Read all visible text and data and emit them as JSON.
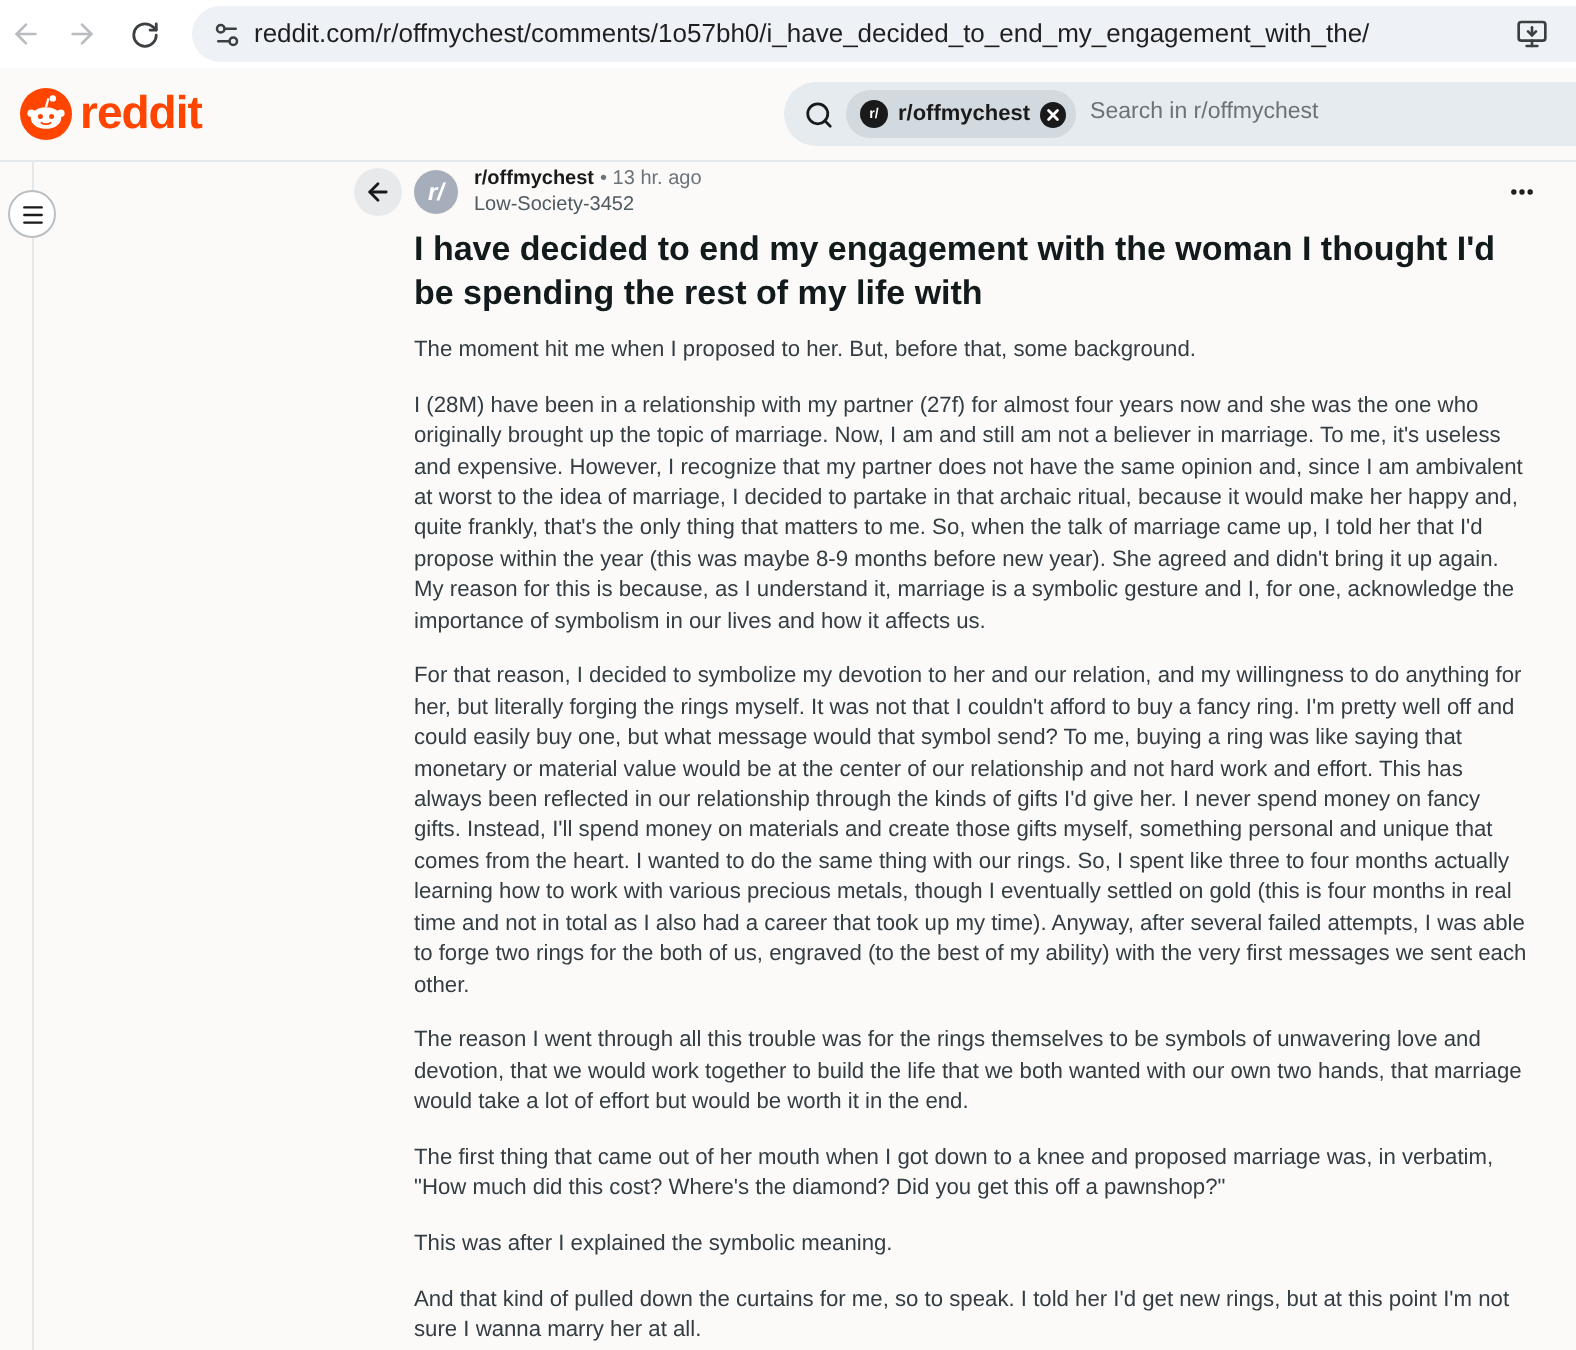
{
  "browser": {
    "back": {
      "disabled": true
    },
    "forward": {
      "disabled": true
    },
    "url": "reddit.com/r/offmychest/comments/1o57bh0/i_have_decided_to_end_my_engagement_with_the/"
  },
  "header": {
    "logo_text": "reddit",
    "search": {
      "chip": {
        "icon_text": "r/",
        "label": "r/offmychest"
      },
      "placeholder": "Search in r/offmychest"
    }
  },
  "post": {
    "avatar_text": "r/",
    "subreddit": "r/offmychest",
    "time": "• 13 hr. ago",
    "author": "Low-Society-3452",
    "title": "I have decided to end my engagement with the woman I thought I'd be spending the rest of my life with",
    "paragraphs": [
      "The moment hit me when I proposed to her. But, before that, some background.",
      "I (28M) have been in a relationship with my partner (27f) for almost four years now and she was the one who originally brought up the topic of marriage. Now, I am and still am not a believer in marriage. To me, it's useless and expensive. However, I recognize that my partner does not have the same opinion and, since I am ambivalent at worst to the idea of marriage, I decided to partake in that archaic ritual, because it would make her happy and, quite frankly, that's the only thing that matters to me. So, when the talk of marriage came up, I told her that I'd propose within the year (this was maybe 8-9 months before new year). She agreed and didn't bring it up again. My reason for this is because, as I understand it, marriage is a symbolic gesture and I, for one, acknowledge the importance of symbolism in our lives and how it affects us.",
      "For that reason, I decided to symbolize my devotion to her and our relation, and my willingness to do anything for her, but literally forging the rings myself. It was not that I couldn't afford to buy a fancy ring. I'm pretty well off and could easily buy one, but what message would that symbol send? To me, buying a ring was like saying that monetary or material value would be at the center of our relationship and not hard work and effort. This has always been reflected in our relationship through the kinds of gifts I'd give her. I never spend money on fancy gifts. Instead, I'll spend money on materials and create those gifts myself, something personal and unique that comes from the heart. I wanted to do the same thing with our rings. So, I spent like three to four months actually learning how to work with various precious metals, though I eventually settled on gold (this is four months in real time and not in total as I also had a career that took up my time). Anyway, after several failed attempts, I was able to forge two rings for the both of us, engraved (to the best of my ability) with the very first messages we sent each other.",
      "The reason I went through all this trouble was for the rings themselves to be symbols of unwavering love and devotion, that we would work together to build the life that we both wanted with our own two hands, that marriage would take a lot of effort but would be worth it in the end.",
      "The first thing that came out of her mouth when I got down to a knee and proposed marriage was, in verbatim, \"How much did this cost? Where's the diamond? Did you get this off a pawnshop?\"",
      "This was after I explained the symbolic meaning.",
      "And that kind of pulled down the curtains for me, so to speak. I told her I'd get new rings, but at this point I'm not sure I wanna marry her at all."
    ]
  }
}
